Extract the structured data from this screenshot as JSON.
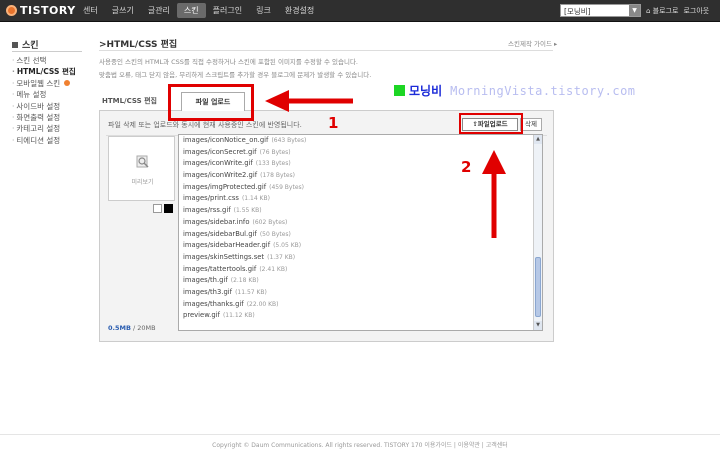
{
  "header": {
    "logo": "TISTORY",
    "nav": [
      "센터",
      "글쓰기",
      "글관리",
      "스킨",
      "플러그인",
      "링크",
      "환경설정"
    ],
    "active_nav": 3,
    "blog_select": "[모닝비]",
    "links": [
      "⌂ 블로그로",
      "로그아웃"
    ]
  },
  "sidebar": {
    "title": "스킨",
    "items": [
      "스킨 선택",
      "HTML/CSS 편집",
      "모바일웹 스킨",
      "메뉴 설정",
      "사이드바 설정",
      "화면출력 설정",
      "카테고리 설정",
      "티에디션 설정"
    ],
    "current_index": 1
  },
  "main": {
    "title": ">HTML/CSS 편집",
    "guide_link": "스킨제작 가이드 ▸",
    "description": [
      "사용중인 스킨의 HTML과 CSS를 직접 수정하거나 스킨에 포함된 이미지를 수정할 수 있습니다.",
      "맞춤법 오류, 태그 닫지 않음, 무리하게 스크립트를 추가할 경우 블로그에 문제가 발생할 수 있습니다."
    ],
    "tabs": [
      "HTML/CSS 편집",
      "파일 업로드"
    ],
    "panel_note": "파일 삭제 또는 업로드와 동시에 현재 사용중인 스킨에 반영됩니다.",
    "upload_button": "파일업로드",
    "delete_button": "삭제",
    "preview_label": "미리보기",
    "usage_used": "0.5MB",
    "usage_total": " / 20MB",
    "files": [
      {
        "name": "images/iconNotice_on.gif",
        "size": "(643 Bytes)"
      },
      {
        "name": "images/iconSecret.gif",
        "size": "(76 Bytes)"
      },
      {
        "name": "images/iconWrite.gif",
        "size": "(133 Bytes)"
      },
      {
        "name": "images/iconWrite2.gif",
        "size": "(178 Bytes)"
      },
      {
        "name": "images/imgProtected.gif",
        "size": "(459 Bytes)"
      },
      {
        "name": "images/print.css",
        "size": "(1.14 KB)"
      },
      {
        "name": "images/rss.gif",
        "size": "(1.55 KB)"
      },
      {
        "name": "images/sidebar.info",
        "size": "(602 Bytes)"
      },
      {
        "name": "images/sidebarBul.gif",
        "size": "(50 Bytes)"
      },
      {
        "name": "images/sidebarHeader.gif",
        "size": "(5.05 KB)"
      },
      {
        "name": "images/skinSettings.set",
        "size": "(1.37 KB)"
      },
      {
        "name": "images/tattertools.gif",
        "size": "(2.41 KB)"
      },
      {
        "name": "images/th.gif",
        "size": "(2.18 KB)"
      },
      {
        "name": "images/th3.gif",
        "size": "(11.57 KB)"
      },
      {
        "name": "images/thanks.gif",
        "size": "(22.00 KB)"
      },
      {
        "name": "preview.gif",
        "size": "(11.12 KB)"
      }
    ]
  },
  "annotations": {
    "brand_name": "모닝비",
    "brand_url": "MorningVista.tistory.com",
    "step1": "1",
    "step2": "2",
    "color": "#e00000"
  },
  "footer": "Copyright © Daum Communications. All rights reserved. TISTORY 170  이용가이드 | 이용약관 | 고객센터"
}
